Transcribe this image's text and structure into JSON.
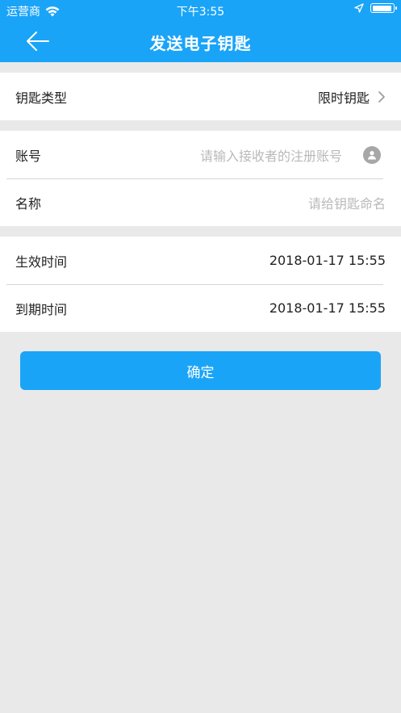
{
  "status_bar": {
    "carrier": "运营商",
    "time": "下午3:55",
    "battery_level": 0.95
  },
  "nav": {
    "title": "发送电子钥匙",
    "back_icon": "arrow-left-icon"
  },
  "key_type": {
    "label": "钥匙类型",
    "value": "限时钥匙"
  },
  "account": {
    "label": "账号",
    "placeholder": "请输入接收者的注册账号",
    "icon": "contact-icon"
  },
  "name": {
    "label": "名称",
    "placeholder": "请给钥匙命名"
  },
  "effective_time": {
    "label": "生效时间",
    "value": "2018-01-17 15:55"
  },
  "expire_time": {
    "label": "到期时间",
    "value": "2018-01-17 15:55"
  },
  "confirm_button": {
    "label": "确定"
  },
  "colors": {
    "accent": "#1aa4f8",
    "background": "#e9e9e9",
    "placeholder": "#b9b9b9"
  }
}
